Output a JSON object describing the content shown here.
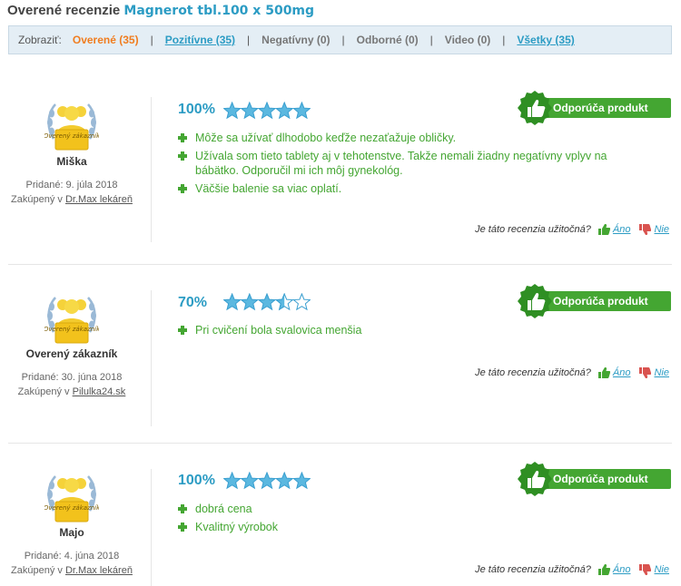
{
  "header": {
    "title": "Overené recenzie",
    "product": "Magnerot tbl.100 x 500mg"
  },
  "filter": {
    "label": "Zobraziť:",
    "items": [
      {
        "label": "Overené (35)",
        "state": "active"
      },
      {
        "label": "Pozitívne (35)",
        "state": "link"
      },
      {
        "label": "Negatívny (0)",
        "state": "disabled"
      },
      {
        "label": "Odborné (0)",
        "state": "disabled"
      },
      {
        "label": "Video (0)",
        "state": "disabled"
      },
      {
        "label": "Všetky (35)",
        "state": "link"
      }
    ],
    "separator": "|"
  },
  "badge_text": "Overený zákazník",
  "recommend_label": "Odporúča produkt",
  "helpful": {
    "question": "Je táto recenzia užitočná?",
    "yes": "Áno",
    "no": "Nie"
  },
  "colors": {
    "accent": "#2c9cc4",
    "active": "#f07d1f",
    "green": "#44a632",
    "red": "#d9534f",
    "star": "#5bb8e0"
  },
  "reviews": [
    {
      "author": "Miška",
      "added": "Pridané: 9. júla 2018",
      "bought_prefix": "Zakúpený v",
      "shop": "Dr.Max lekáreň",
      "score": "100%",
      "rating": 5,
      "pros": [
        "Môže sa užívať dlhodobo keďže nezaťažuje obličky.",
        "Užívala som tieto tablety aj v tehotenstve. Takže nemali žiadny negatívny vplyv na bábätko. Odporučil mi ich môj gynekológ.",
        "Väčšie balenie sa viac oplatí."
      ]
    },
    {
      "author": "Overený zákazník",
      "added": "Pridané: 30. júna 2018",
      "bought_prefix": "Zakúpený v",
      "shop": "Pilulka24.sk",
      "score": "70%",
      "rating": 3.5,
      "pros": [
        "Pri cvičení bola svalovica menšia"
      ]
    },
    {
      "author": "Majo",
      "added": "Pridané: 4. júna 2018",
      "bought_prefix": "Zakúpený v",
      "shop": "Dr.Max lekáreň",
      "score": "100%",
      "rating": 5,
      "pros": [
        "dobrá cena",
        "Kvalitný výrobok"
      ]
    }
  ]
}
